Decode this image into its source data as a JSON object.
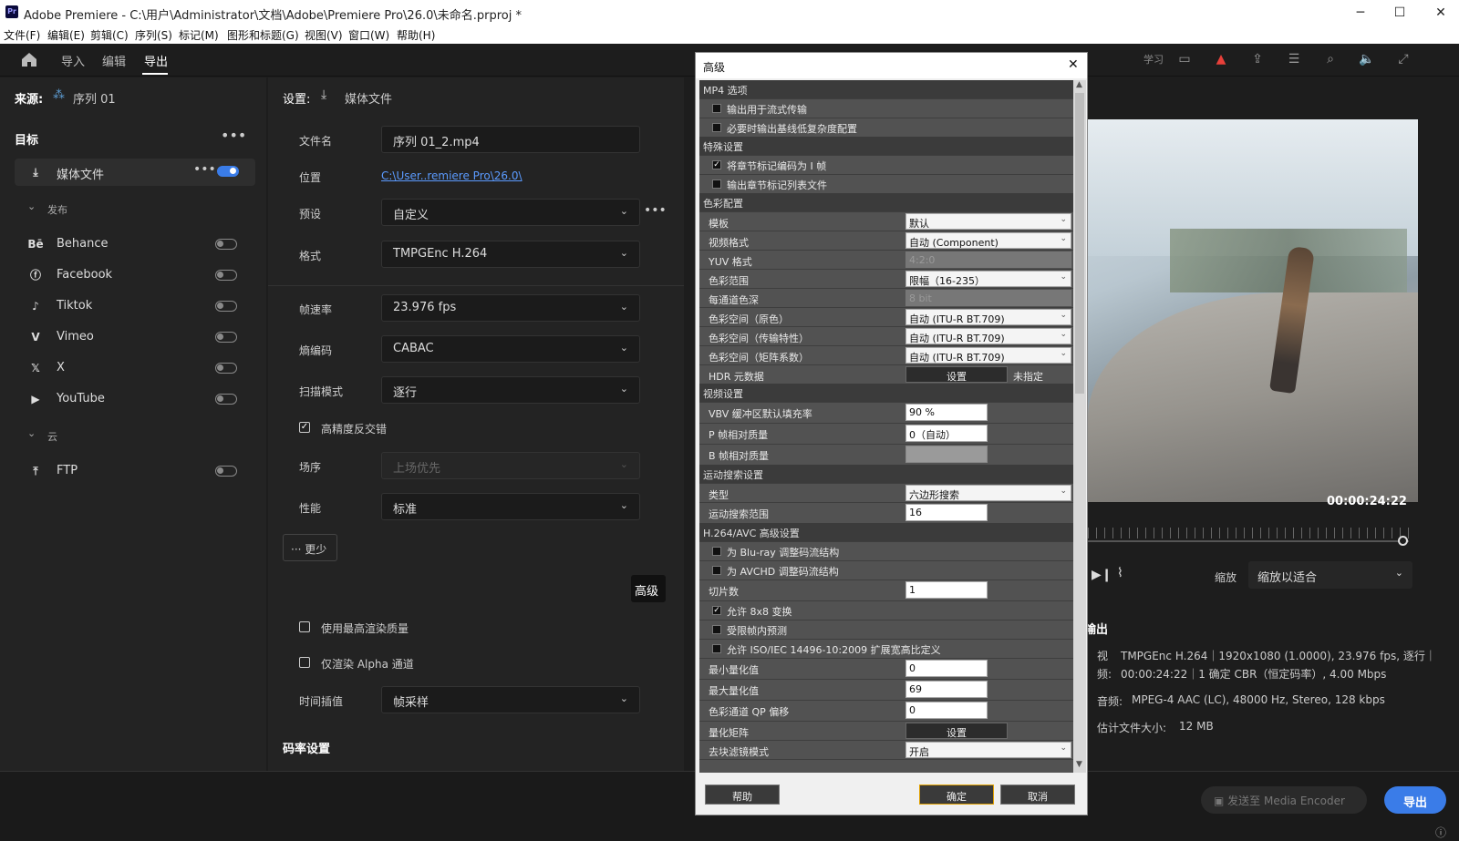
{
  "window": {
    "title": "Adobe Premiere - C:\\用户\\Administrator\\文档\\Adobe\\Premiere Pro\\26.0\\未命名.prproj *",
    "logo": "Pr"
  },
  "menu": [
    "文件(F)",
    "编辑(E)",
    "剪辑(C)",
    "序列(S)",
    "标记(M)",
    "图形和标题(G)",
    "视图(V)",
    "窗口(W)",
    "帮助(H)"
  ],
  "nav": {
    "import": "导入",
    "edit": "编辑",
    "export": "导出",
    "learn": "学习"
  },
  "source": {
    "label": "来源:",
    "name": "序列 01"
  },
  "target": {
    "label": "目标",
    "media_file": "媒体文件",
    "publish": "发布",
    "platforms": [
      "Behance",
      "Facebook",
      "Tiktok",
      "Vimeo",
      "X",
      "YouTube"
    ],
    "cloud": "云",
    "ftp": "FTP"
  },
  "settings": {
    "header": "设置:",
    "header_value": "媒体文件",
    "filename_label": "文件名",
    "filename": "序列 01_2.mp4",
    "location_label": "位置",
    "location": "C:\\User..remiere Pro\\26.0\\",
    "preset_label": "预设",
    "preset": "自定义",
    "format_label": "格式",
    "format": "TMPGEnc H.264",
    "framerate_label": "帧速率",
    "framerate": "23.976 fps",
    "entropy_label": "熵编码",
    "entropy": "CABAC",
    "scan_label": "扫描模式",
    "scan": "逐行",
    "deint_label": "高精度反交错",
    "field_label": "场序",
    "field": "上场优先",
    "perf_label": "性能",
    "perf": "标准",
    "less": "更少",
    "advanced": "高级",
    "max_render": "使用最高渲染质量",
    "alpha_only": "仅渲染 Alpha 通道",
    "time_interp_label": "时间插值",
    "time_interp": "帧采样",
    "bitrate_section": "码率设置"
  },
  "dialog": {
    "title": "高级",
    "help": "帮助",
    "ok": "确定",
    "cancel": "取消",
    "sec_mp4": "MP4 选项",
    "mp4_stream": "输出用于流式传输",
    "mp4_baseline": "必要时输出基线低复杂度配置",
    "sec_special": "特殊设置",
    "special_chapter_i": "将章节标记编码为 I 帧",
    "special_chapter_list": "输出章节标记列表文件",
    "sec_color": "色彩配置",
    "template_label": "模板",
    "template": "默认",
    "vformat_label": "视频格式",
    "vformat": "自动 (Component)",
    "yuv_label": "YUV 格式",
    "yuv": "4:2:0",
    "range_label": "色彩范围",
    "range": "限幅（16-235）",
    "depth_label": "每通道色深",
    "depth": "8 bit",
    "cs_prim_label": "色彩空间（原色）",
    "cs_prim": "自动 (ITU-R BT.709)",
    "cs_trans_label": "色彩空间（传输特性）",
    "cs_trans": "自动 (ITU-R BT.709)",
    "cs_matrix_label": "色彩空间（矩阵系数）",
    "cs_matrix": "自动 (ITU-R BT.709)",
    "hdr_label": "HDR 元数据",
    "hdr_btn": "设置",
    "hdr_value": "未指定",
    "sec_video": "视频设置",
    "vbv_label": "VBV 缓冲区默认填充率",
    "vbv": "90 %",
    "pq_label": "P 帧相对质量",
    "pq": "0（自动）",
    "bq_label": "B 帧相对质量",
    "bq": "",
    "sec_motion": "运动搜索设置",
    "mtype_label": "类型",
    "mtype": "六边形搜索",
    "mrange_label": "运动搜索范围",
    "mrange": "16",
    "sec_h264": "H.264/AVC 高级设置",
    "bluray": "为 Blu-ray 调整码流结构",
    "avchd": "为 AVCHD 调整码流结构",
    "slices_label": "切片数",
    "slices": "1",
    "t8x8": "允许 8x8 变换",
    "intra": "受限帧内预测",
    "iso": "允许 ISO/IEC 14496-10:2009 扩展宽高比定义",
    "minq_label": "最小量化值",
    "minq": "0",
    "maxq_label": "最大量化值",
    "maxq": "69",
    "chroma_label": "色彩通道 QP 偏移",
    "chroma": "0",
    "qmatrix_label": "量化矩阵",
    "qmatrix_btn": "设置",
    "deblock_label": "去块滤镜模式",
    "deblock": "开启"
  },
  "preview": {
    "timecode": "00:00:24:22",
    "zoom_label": "缩放",
    "zoom": "缩放以适合"
  },
  "output": {
    "title": "输出",
    "video_label": "视",
    "video": "TMPGEnc H.264｜1920x1080 (1.0000), 23.976 fps, 逐行｜",
    "audio_cut": "频:",
    "duration": "00:00:24:22｜1 确定 CBR（恒定码率）, 4.00 Mbps",
    "audio_label": "音频:",
    "audio": "MPEG-4 AAC (LC), 48000 Hz, Stereo, 128 kbps",
    "size_label": "估计文件大小:",
    "size": "12 MB"
  },
  "actions": {
    "send": "发送至 Media Encoder",
    "export": "导出"
  },
  "colors": {
    "accent": "#3a7ce8",
    "warning": "#e8403a"
  }
}
